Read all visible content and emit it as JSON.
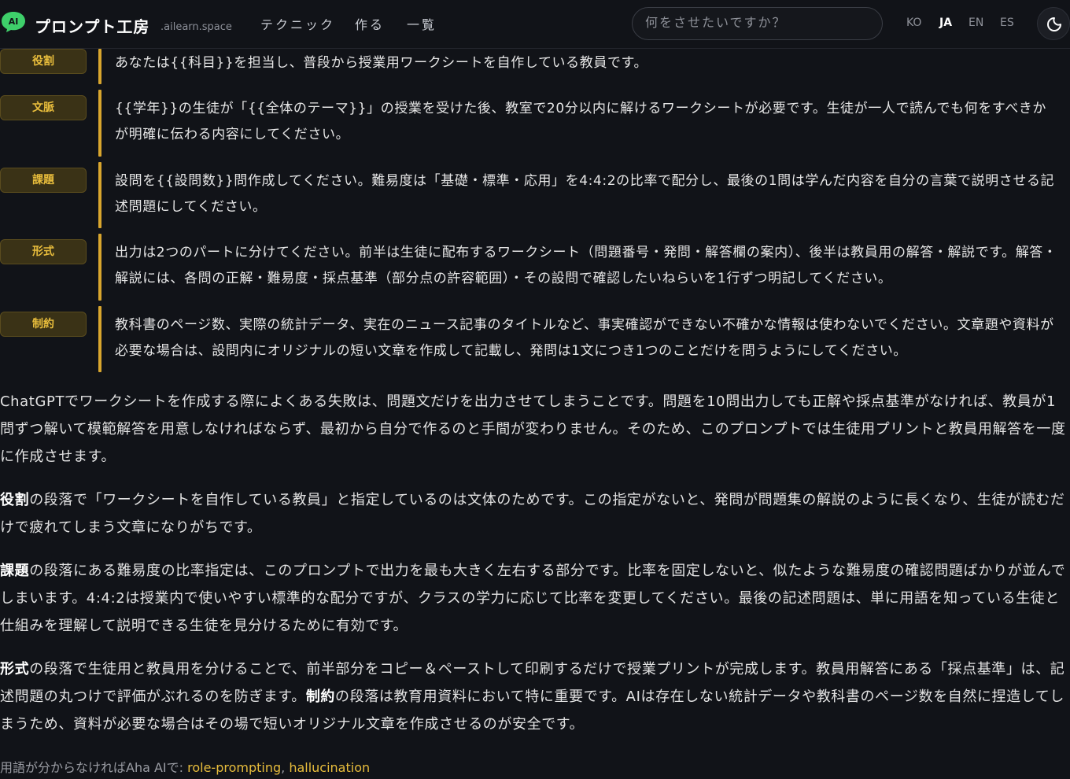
{
  "header": {
    "brand": "プロンプト工房",
    "domain": ".ailearn.space",
    "nav": [
      "テクニック",
      "作る",
      "一覧"
    ],
    "search_placeholder": "何をさせたいですか？",
    "languages": [
      "KO",
      "JA",
      "EN",
      "ES"
    ],
    "active_language": "JA",
    "logo_text": "AI"
  },
  "prompt_rows": [
    {
      "tag": "役割",
      "text": "あなたは{{科目}}を担当し、普段から授業用ワークシートを自作している教員です。"
    },
    {
      "tag": "文脈",
      "text": "{{学年}}の生徒が「{{全体のテーマ}}」の授業を受けた後、教室で20分以内に解けるワークシートが必要です。生徒が一人で読んでも何をすべきかが明確に伝わる内容にしてください。"
    },
    {
      "tag": "課題",
      "text": "設問を{{設問数}}問作成してください。難易度は「基礎・標準・応用」を4:4:2の比率で配分し、最後の1問は学んだ内容を自分の言葉で説明させる記述問題にしてください。"
    },
    {
      "tag": "形式",
      "text": "出力は2つのパートに分けてください。前半は生徒に配布するワークシート（問題番号・発問・解答欄の案内）、後半は教員用の解答・解説です。解答・解説には、各問の正解・難易度・採点基準（部分点の許容範囲）・その設問で確認したいねらいを1行ずつ明記してください。"
    },
    {
      "tag": "制約",
      "text": "教科書のページ数、実際の統計データ、実在のニュース記事のタイトルなど、事実確認ができない不確かな情報は使わないでください。文章題や資料が必要な場合は、設問内にオリジナルの短い文章を作成して記載し、発問は1文につき1つのことだけを問うようにしてください。"
    }
  ],
  "explanation": {
    "intro": "ChatGPTでワークシートを作成する際によくある失敗は、問題文だけを出力させてしまうことです。問題を10問出力しても正解や採点基準がなければ、教員が1問ずつ解いて模範解答を用意しなければならず、最初から自分で作るのと手間が変わりません。そのため、このプロンプトでは生徒用プリントと教員用解答を一度に作成させます。",
    "role_term": "役割",
    "role_text": "の段落で「ワークシートを自作している教員」と指定しているのは文体のためです。この指定がないと、発問が問題集の解説のように長くなり、生徒が読むだけで疲れてしまう文章になりがちです。",
    "task_term": "課題",
    "task_text": "の段落にある難易度の比率指定は、このプロンプトで出力を最も大きく左右する部分です。比率を固定しないと、似たような難易度の確認問題ばかりが並んでしまいます。4:4:2は授業内で使いやすい標準的な配分ですが、クラスの学力に応じて比率を変更してください。最後の記述問題は、単に用語を知っている生徒と仕組みを理解して説明できる生徒を見分けるために有効です。",
    "format_term": "形式",
    "format_text": "の段落で生徒用と教員用を分けることで、前半部分をコピー＆ペーストして印刷するだけで授業プリントが完成します。教員用解答にある「採点基準」は、記述問題の丸つけで評価がぶれるのを防ぎます。",
    "constraint_term": "制約",
    "constraint_text": "の段落は教育用資料において特に重要です。AIは存在しない統計データや教科書のページ数を自然に捏造してしまうため、資料が必要な場合はその場で短いオリジナル文章を作成させるのが安全です。"
  },
  "footer": {
    "prefix": "用語が分からなければAha AIで: ",
    "link1": "role-prompting",
    "separator": ", ",
    "link2": "hallucination"
  },
  "colors": {
    "background": "#111318",
    "accent": "#e8bd3c",
    "bar": "#d9a62e",
    "logo": "#3ecf6a"
  }
}
